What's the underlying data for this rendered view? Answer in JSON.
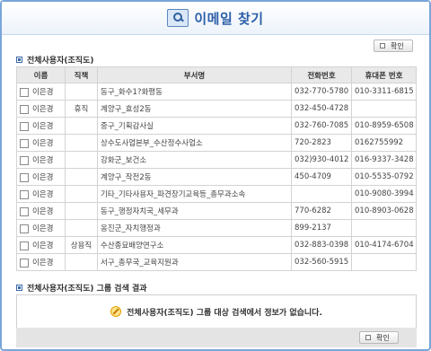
{
  "header": {
    "title": "이메일 찾기",
    "icon": "search-mail-icon"
  },
  "top_button": {
    "label": "확인"
  },
  "section1": {
    "title": "전체사용자(조직도)",
    "columns": [
      "이름",
      "직책",
      "부서명",
      "전화번호",
      "휴대폰 번호"
    ],
    "rows": [
      {
        "name": "이은경",
        "position": "",
        "dept": "동구_화수1?화평동",
        "phone": "032-770-5780",
        "mobile": "010-3311-6815"
      },
      {
        "name": "이은경",
        "position": "휴직",
        "dept": "계양구_효성2동",
        "phone": "032-450-4728",
        "mobile": ""
      },
      {
        "name": "이은경",
        "position": "",
        "dept": "중구_기획감사실",
        "phone": "032-760-7085",
        "mobile": "010-8959-6508"
      },
      {
        "name": "이은경",
        "position": "",
        "dept": "상수도사업본부_수산정수사업소",
        "phone": "720-2823",
        "mobile": "0162755992"
      },
      {
        "name": "이은경",
        "position": "",
        "dept": "강화군_보건소",
        "phone": "032)930-4012",
        "mobile": "016-9337-3428"
      },
      {
        "name": "이은경",
        "position": "",
        "dept": "계양구_작전2동",
        "phone": "450-4709",
        "mobile": "010-5535-0792"
      },
      {
        "name": "이은경",
        "position": "",
        "dept": "기타_기타사용자_파견장기교육등_총무과소속",
        "phone": "",
        "mobile": "010-9080-3994"
      },
      {
        "name": "이은경",
        "position": "",
        "dept": "동구_행정자치국_세무과",
        "phone": "770-6282",
        "mobile": "010-8903-0628"
      },
      {
        "name": "이은경",
        "position": "",
        "dept": "옹진군_자치행정과",
        "phone": "899-2137",
        "mobile": ""
      },
      {
        "name": "이은경",
        "position": "상용직",
        "dept": "수산종묘배양연구소",
        "phone": "032-883-0398",
        "mobile": "010-4174-6704"
      },
      {
        "name": "이은경",
        "position": "",
        "dept": "서구_총무국_교육지원과",
        "phone": "032-560-5915",
        "mobile": ""
      }
    ]
  },
  "section2": {
    "title": "전체사용자(조직도) 그룹 검색 결과",
    "message": "전체사용자(조직도) 그룹 대상 검색에서 정보가 없습니다."
  },
  "bottom_button": {
    "label": "확인"
  }
}
